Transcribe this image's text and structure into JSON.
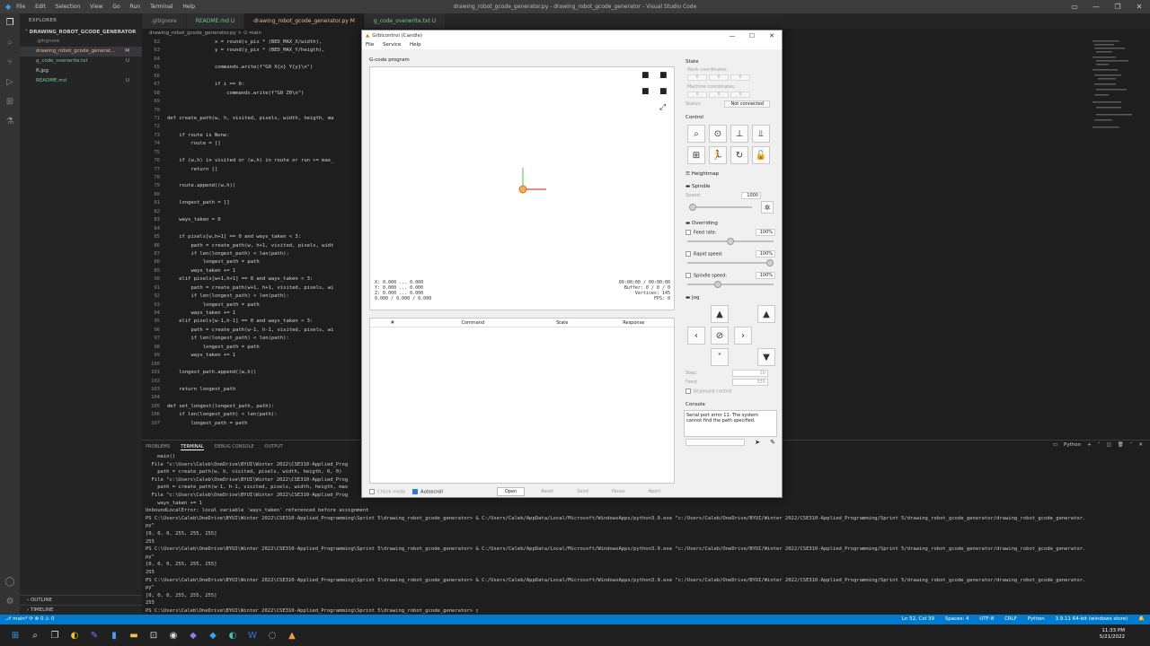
{
  "vscode": {
    "menu": [
      "File",
      "Edit",
      "Selection",
      "View",
      "Go",
      "Run",
      "Terminal",
      "Help"
    ],
    "title": "drawing_robot_gcode_generator.py - drawing_robot_gcode_generator - Visual Studio Code",
    "explorer_header": "EXPLORER",
    "project": "DRAWING_ROBOT_GCODE_GENERATOR",
    "files": [
      {
        "name": ".gitignore",
        "badge": ""
      },
      {
        "name": "drawing_robot_gcode_generat...",
        "badge": "M"
      },
      {
        "name": "g_code_overwrite.txt",
        "badge": "U"
      },
      {
        "name": "R.jpg",
        "badge": ""
      },
      {
        "name": "README.md",
        "badge": "U"
      }
    ],
    "outline": "OUTLINE",
    "timeline": "TIMELINE",
    "tabs": [
      {
        "label": ".gitignore"
      },
      {
        "label": "README.md  U"
      },
      {
        "label": "drawing_robot_gcode_generator.py  M"
      },
      {
        "label": "g_code_overwrite.txt  U"
      }
    ],
    "breadcrumb": "drawing_robot_gcode_generator.py > ⊙ main",
    "code": [
      {
        "n": "62",
        "t": "                x = round(x_pix * (BED_MAX_X/width),"
      },
      {
        "n": "63",
        "t": "                y = round(y_pix * (BED_MAX_Y/heigth),"
      },
      {
        "n": "64",
        "t": ""
      },
      {
        "n": "65",
        "t": "                commands.write(f\"G0 X{x} Y{y}\\n\")"
      },
      {
        "n": "66",
        "t": ""
      },
      {
        "n": "67",
        "t": "                if i == 0:"
      },
      {
        "n": "68",
        "t": "                    commands.write(f\"G0 Z0\\n\")"
      },
      {
        "n": "69",
        "t": ""
      },
      {
        "n": "70",
        "t": ""
      },
      {
        "n": "71",
        "t": "def create_path(w, h, visited, pixels, width, heigth, ma"
      },
      {
        "n": "72",
        "t": ""
      },
      {
        "n": "73",
        "t": "    if route is None:"
      },
      {
        "n": "74",
        "t": "        route = []"
      },
      {
        "n": "75",
        "t": ""
      },
      {
        "n": "76",
        "t": "    if (w,h) in visited or (w,h) in route or run >= max_"
      },
      {
        "n": "77",
        "t": "        return []"
      },
      {
        "n": "78",
        "t": ""
      },
      {
        "n": "79",
        "t": "    route.append((w,h))"
      },
      {
        "n": "80",
        "t": ""
      },
      {
        "n": "81",
        "t": "    longest_path = []"
      },
      {
        "n": "82",
        "t": ""
      },
      {
        "n": "83",
        "t": "    ways_taken = 0"
      },
      {
        "n": "84",
        "t": ""
      },
      {
        "n": "85",
        "t": "    if pixels[w,h+1] == 0 and ways_taken < 3:"
      },
      {
        "n": "86",
        "t": "        path = create_path(w, h+1, visited, pixels, widt"
      },
      {
        "n": "87",
        "t": "        if len(longest_path) < len(path):"
      },
      {
        "n": "88",
        "t": "            longest_path = path"
      },
      {
        "n": "89",
        "t": "        ways_taken += 1"
      },
      {
        "n": "90",
        "t": "    elif pixels[w+1,h+1] == 0 and ways_taken < 3:"
      },
      {
        "n": "91",
        "t": "        path = create_path(w+1, h+1, visited, pixels, wi"
      },
      {
        "n": "92",
        "t": "        if len(longest_path) < len(path):"
      },
      {
        "n": "93",
        "t": "            longest_path = path"
      },
      {
        "n": "94",
        "t": "        ways_taken += 1"
      },
      {
        "n": "95",
        "t": "    elif pixels[w-1,h-1] == 0 and ways_taken < 3:"
      },
      {
        "n": "96",
        "t": "        path = create_path(w-1, h-1, visited, pixels, wi"
      },
      {
        "n": "97",
        "t": "        if len(longest_path) < len(path):"
      },
      {
        "n": "98",
        "t": "            longest_path = path"
      },
      {
        "n": "99",
        "t": "        ways_taken += 1"
      },
      {
        "n": "100",
        "t": ""
      },
      {
        "n": "101",
        "t": "    longest_path.append((w,h))"
      },
      {
        "n": "102",
        "t": ""
      },
      {
        "n": "103",
        "t": "    return longest_path"
      },
      {
        "n": "104",
        "t": ""
      },
      {
        "n": "105",
        "t": "def set_longest(longest_path, path):"
      },
      {
        "n": "106",
        "t": "    if len(longest_path) < len(path):"
      },
      {
        "n": "107",
        "t": "        longest_path = path"
      }
    ],
    "panel_tabs": [
      "PROBLEMS",
      "TERMINAL",
      "DEBUG CONSOLE",
      "OUTPUT"
    ],
    "panel_right": "Python",
    "terminal": [
      {
        "t": "    main()",
        "c": ""
      },
      {
        "t": "  File \"c:\\Users\\Caleb\\OneDrive\\BYUI\\Winter 2022\\CSE310-Applied_Prog",
        "c": ""
      },
      {
        "t": "    path = create_path(w, h, visited, pixels, width, heigth, 0, 0)",
        "c": ""
      },
      {
        "t": "  File \"c:\\Users\\Caleb\\OneDrive\\BYUI\\Winter 2022\\CSE310-Applied_Prog",
        "c": ""
      },
      {
        "t": "    path = create_path(w-1, h-1, visited, pixels, width, heigth, max",
        "c": ""
      },
      {
        "t": "  File \"c:\\Users\\Caleb\\OneDrive\\BYUI\\Winter 2022\\CSE310-Applied_Prog",
        "c": ""
      },
      {
        "t": "    ways_taken += 1",
        "c": ""
      },
      {
        "t": "UnboundLocalError: local variable 'ways_taken' referenced before assignment",
        "c": ""
      },
      {
        "t": "PS C:\\Users\\Caleb\\OneDrive\\BYUI\\Winter 2022\\CSE310-Applied_Programming\\Sprint 5\\drawing_robot_gcode_generator> & C:/Users/Caleb/AppData/Local/Microsoft/WindowsApps/python3.9.exe \"c:/Users/Caleb/OneDrive/BYUI/Winter 2022/CSE310-Applied_Programming/Sprint 5/drawing_robot_gcode_generator/drawing_robot_gcode_generator.",
        "c": "yl"
      },
      {
        "t": "py\"",
        "c": "bl"
      },
      {
        "t": "[0, 0, 0, 255, 255, 255]",
        "c": ""
      },
      {
        "t": "255",
        "c": ""
      },
      {
        "t": "PS C:\\Users\\Caleb\\OneDrive\\BYUI\\Winter 2022\\CSE310-Applied_Programming\\Sprint 5\\drawing_robot_gcode_generator> & C:/Users/Caleb/AppData/Local/Microsoft/WindowsApps/python3.9.exe \"c:/Users/Caleb/OneDrive/BYUI/Winter 2022/CSE310-Applied_Programming/Sprint 5/drawing_robot_gcode_generator/drawing_robot_gcode_generator.",
        "c": "yl"
      },
      {
        "t": "py\"",
        "c": "bl"
      },
      {
        "t": "[0, 0, 0, 255, 255, 255]",
        "c": ""
      },
      {
        "t": "255",
        "c": ""
      },
      {
        "t": "PS C:\\Users\\Caleb\\OneDrive\\BYUI\\Winter 2022\\CSE310-Applied_Programming\\Sprint 5\\drawing_robot_gcode_generator> & C:/Users/Caleb/AppData/Local/Microsoft/WindowsApps/python3.9.exe \"c:/Users/Caleb/OneDrive/BYUI/Winter 2022/CSE310-Applied_Programming/Sprint 5/drawing_robot_gcode_generator/drawing_robot_gcode_generator.",
        "c": "yl"
      },
      {
        "t": "py\"",
        "c": "bl"
      },
      {
        "t": "[0, 0, 0, 255, 255, 255]",
        "c": ""
      },
      {
        "t": "255",
        "c": ""
      },
      {
        "t": "PS C:\\Users\\Caleb\\OneDrive\\BYUI\\Winter 2022\\CSE310-Applied_Programming\\Sprint 5\\drawing_robot_gcode_generator> ▯",
        "c": ""
      }
    ],
    "status_left": "⎇ main*  ⟳  ⊗ 0 ⚠ 0",
    "status_right": [
      "Ln 52, Col 39",
      "Spaces: 4",
      "UTF-8",
      "CRLF",
      "Python",
      "3.9.11 64-bit (windows store)"
    ],
    "accent": "#007acc"
  },
  "candle": {
    "title": "Grblcontrol (Candle)",
    "menu": [
      "File",
      "Service",
      "Help"
    ],
    "gcode_label": "G-code program",
    "coords": [
      "X: 0.000 ... 0.000",
      "Y: 0.000 ... 0.000",
      "Z: 0.000 ... 0.000",
      "0.000 / 0.000 / 0.000"
    ],
    "stats": [
      "00:00:00 / 00:00:00",
      "Buffer: 0 / 0 / 0",
      "Vertices: 145",
      "FPS: 0"
    ],
    "table_headers": [
      "#",
      "Command",
      "State",
      "Response"
    ],
    "check_mode": "Check mode",
    "autoscroll": "Autoscroll",
    "buttons": {
      "open": "Open",
      "reset": "Reset",
      "send": "Send",
      "pause": "Pause",
      "abort": "Abort"
    },
    "state_header": "State",
    "work_coords": "Work coordinates:",
    "machine_coords": "Machine coordinates:",
    "zero": "0",
    "status_label": "Status:",
    "status_value": "Not connected",
    "control_header": "Control",
    "heightmap": "Heightmap",
    "spindle": "Spindle",
    "speed_label": "Speed:",
    "speed_value": "1000",
    "overriding": "Overriding",
    "feed_rate": "Feed rate:",
    "rapid_speed": "Rapid speed:",
    "spindle_speed": "Spindle speed:",
    "pct": "100%",
    "jog": "Jog",
    "step_label": "Step:",
    "step_value": "10",
    "feed_label": "Feed:",
    "feed_value": "555",
    "keyboard_control": "Keyboard control",
    "console": "Console",
    "console_text": "Serial port error 11: The system cannot find the path specified."
  },
  "taskbar": {
    "time": "11:33 PM",
    "date": "5/21/2022"
  }
}
